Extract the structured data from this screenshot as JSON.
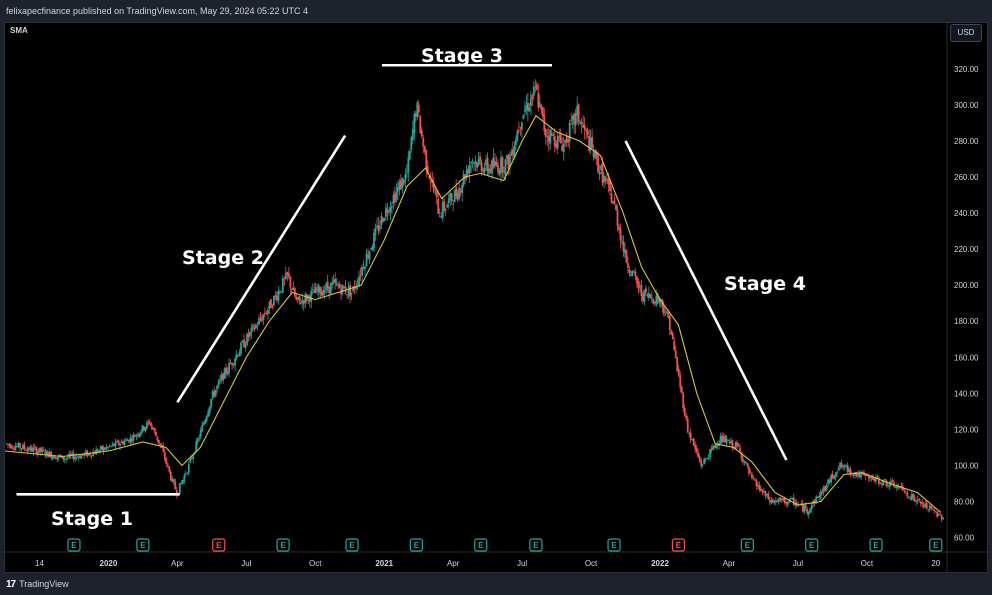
{
  "header": {
    "publisher_line": "felixapecfinance published on TradingView.com, May 29, 2024 05:22 UTC 4",
    "indicator_label": "SMA",
    "currency_button": "USD"
  },
  "footer": {
    "brand_mark": "17",
    "brand_name": "TradingView"
  },
  "colors": {
    "up_candle": "#26a69a",
    "down_candle": "#ef5350",
    "sma_line": "#d4c544",
    "annotation": "#ffffff",
    "axis_text": "#d1d4dc",
    "earnings_badge": "#26a69a",
    "earnings_badge_alt": "#ef5350",
    "background": "#000000"
  },
  "chart_data": {
    "type": "candlestick",
    "y_axis": {
      "ticks": [
        60,
        80,
        100,
        120,
        140,
        160,
        180,
        200,
        220,
        240,
        260,
        280,
        300,
        320
      ],
      "labels": [
        "60.00",
        "80.00",
        "100.00",
        "120.00",
        "140.00",
        "160.00",
        "180.00",
        "200.00",
        "220.00",
        "240.00",
        "260.00",
        "280.00",
        "300.00",
        "320.00"
      ],
      "range": [
        52,
        336
      ]
    },
    "x_axis": {
      "labels": [
        {
          "text": "14",
          "t": 0.0
        },
        {
          "text": "2020",
          "t": 3.0
        },
        {
          "text": "Apr",
          "t": 6.0
        },
        {
          "text": "Jul",
          "t": 9.0
        },
        {
          "text": "Oct",
          "t": 12.0
        },
        {
          "text": "2021",
          "t": 15.0
        },
        {
          "text": "Apr",
          "t": 18.0
        },
        {
          "text": "Jul",
          "t": 21.0
        },
        {
          "text": "Oct",
          "t": 24.0
        },
        {
          "text": "2022",
          "t": 27.0
        },
        {
          "text": "Apr",
          "t": 30.0
        },
        {
          "text": "Jul",
          "t": 33.0
        },
        {
          "text": "Oct",
          "t": 36.0
        },
        {
          "text": "20",
          "t": 39.0
        }
      ],
      "range": [
        -1.5,
        39.4
      ]
    },
    "price_path": [
      [
        -1.5,
        112
      ],
      [
        0,
        108
      ],
      [
        1,
        104
      ],
      [
        2,
        106
      ],
      [
        3,
        110
      ],
      [
        4,
        115
      ],
      [
        4.8,
        124
      ],
      [
        5.3,
        110
      ],
      [
        5.8,
        90
      ],
      [
        6.0,
        85
      ],
      [
        6.5,
        100
      ],
      [
        7.0,
        118
      ],
      [
        7.5,
        138
      ],
      [
        8.0,
        150
      ],
      [
        9.0,
        170
      ],
      [
        10.0,
        188
      ],
      [
        10.8,
        205
      ],
      [
        11.2,
        190
      ],
      [
        12.0,
        196
      ],
      [
        12.8,
        200
      ],
      [
        13.6,
        196
      ],
      [
        14.2,
        215
      ],
      [
        15.0,
        240
      ],
      [
        16.0,
        262
      ],
      [
        16.4,
        300
      ],
      [
        16.8,
        270
      ],
      [
        17.4,
        240
      ],
      [
        18.2,
        252
      ],
      [
        18.8,
        270
      ],
      [
        19.5,
        265
      ],
      [
        20.4,
        268
      ],
      [
        21.0,
        295
      ],
      [
        21.6,
        308
      ],
      [
        22.0,
        285
      ],
      [
        22.8,
        278
      ],
      [
        23.4,
        295
      ],
      [
        24.2,
        270
      ],
      [
        25.0,
        245
      ],
      [
        25.5,
        215
      ],
      [
        26.2,
        195
      ],
      [
        27.0,
        192
      ],
      [
        27.4,
        180
      ],
      [
        27.8,
        150
      ],
      [
        28.2,
        120
      ],
      [
        28.8,
        100
      ],
      [
        29.6,
        115
      ],
      [
        30.4,
        110
      ],
      [
        31.0,
        92
      ],
      [
        31.8,
        80
      ],
      [
        32.8,
        80
      ],
      [
        33.4,
        75
      ],
      [
        34.2,
        88
      ],
      [
        34.8,
        100
      ],
      [
        35.6,
        95
      ],
      [
        36.4,
        92
      ],
      [
        37.4,
        88
      ],
      [
        38.2,
        80
      ],
      [
        39.2,
        72
      ]
    ],
    "sma_path": [
      [
        -1.5,
        108
      ],
      [
        1,
        105
      ],
      [
        3,
        108
      ],
      [
        4.5,
        113
      ],
      [
        5.5,
        110
      ],
      [
        6.2,
        100
      ],
      [
        7.0,
        110
      ],
      [
        8.0,
        135
      ],
      [
        9.0,
        160
      ],
      [
        10.0,
        180
      ],
      [
        11.0,
        196
      ],
      [
        12.0,
        192
      ],
      [
        13.0,
        196
      ],
      [
        14.0,
        200
      ],
      [
        15.0,
        225
      ],
      [
        16.0,
        255
      ],
      [
        16.8,
        265
      ],
      [
        17.5,
        248
      ],
      [
        18.5,
        260
      ],
      [
        19.2,
        262
      ],
      [
        20.2,
        258
      ],
      [
        21.0,
        280
      ],
      [
        21.6,
        294
      ],
      [
        22.5,
        285
      ],
      [
        23.5,
        280
      ],
      [
        24.4,
        272
      ],
      [
        25.4,
        240
      ],
      [
        26.2,
        210
      ],
      [
        27.0,
        192
      ],
      [
        27.8,
        178
      ],
      [
        28.6,
        140
      ],
      [
        29.4,
        112
      ],
      [
        30.2,
        110
      ],
      [
        31.0,
        102
      ],
      [
        32.0,
        85
      ],
      [
        33.0,
        78
      ],
      [
        34.0,
        80
      ],
      [
        35.0,
        95
      ],
      [
        35.8,
        96
      ],
      [
        37.0,
        90
      ],
      [
        38.2,
        85
      ],
      [
        39.2,
        74
      ]
    ],
    "earnings_markers": [
      {
        "t": 1.5,
        "label": "E",
        "kind": "up"
      },
      {
        "t": 4.5,
        "label": "E",
        "kind": "up"
      },
      {
        "t": 7.8,
        "label": "E",
        "kind": "down"
      },
      {
        "t": 10.6,
        "label": "E",
        "kind": "up"
      },
      {
        "t": 13.6,
        "label": "E",
        "kind": "up"
      },
      {
        "t": 16.4,
        "label": "E",
        "kind": "up"
      },
      {
        "t": 19.2,
        "label": "E",
        "kind": "up"
      },
      {
        "t": 21.6,
        "label": "E",
        "kind": "up"
      },
      {
        "t": 25.0,
        "label": "E",
        "kind": "up"
      },
      {
        "t": 27.8,
        "label": "E",
        "kind": "down"
      },
      {
        "t": 30.8,
        "label": "E",
        "kind": "up"
      },
      {
        "t": 33.6,
        "label": "E",
        "kind": "up"
      },
      {
        "t": 36.4,
        "label": "E",
        "kind": "up"
      },
      {
        "t": 39.0,
        "label": "E",
        "kind": "up"
      }
    ],
    "annotations": [
      {
        "id": "stage-1",
        "text": "Stage 1"
      },
      {
        "id": "stage-2",
        "text": "Stage 2"
      },
      {
        "id": "stage-3",
        "text": "Stage 3"
      },
      {
        "id": "stage-4",
        "text": "Stage 4"
      }
    ],
    "annotation_lines": [
      {
        "id": "stage-1-line",
        "from": [
          -1.0,
          84
        ],
        "to": [
          6.1,
          84
        ]
      },
      {
        "id": "stage-2-line",
        "from": [
          6.0,
          135
        ],
        "to": [
          13.3,
          283
        ]
      },
      {
        "id": "stage-3-line",
        "from": [
          14.9,
          322
        ],
        "to": [
          22.3,
          322
        ]
      },
      {
        "id": "stage-4-line",
        "from": [
          25.5,
          280
        ],
        "to": [
          32.5,
          103
        ]
      }
    ]
  }
}
